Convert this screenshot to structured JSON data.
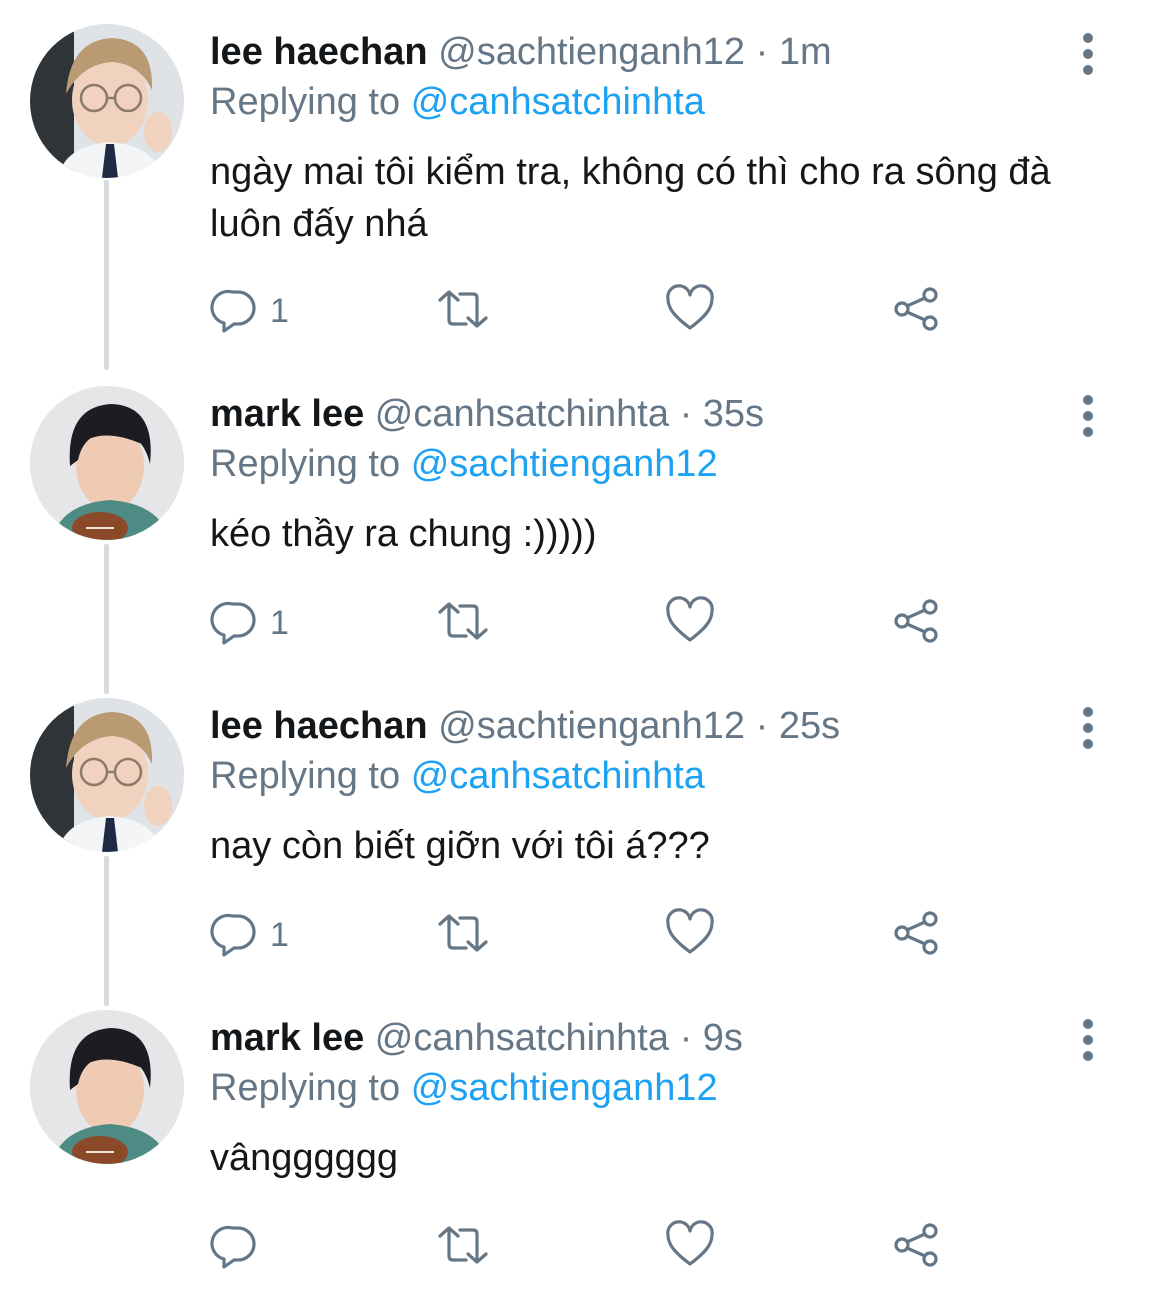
{
  "tweets": [
    {
      "name": "lee haechan",
      "handle": "@sachtienganh12",
      "separator": "·",
      "time": "1m",
      "replying_prefix": "Replying to",
      "replying_to": "@canhsatchinhta",
      "text": "ngày mai tôi kiểm tra, không có thì cho ra sông đà luôn đấy nhá",
      "reply_count": "1",
      "avatar": "haechan-avatar"
    },
    {
      "name": "mark lee",
      "handle": "@canhsatchinhta",
      "separator": "·",
      "time": "35s",
      "replying_prefix": "Replying to",
      "replying_to": "@sachtienganh12",
      "text": "kéo thầy ra chung :)))))",
      "reply_count": "1",
      "avatar": "mark-avatar"
    },
    {
      "name": "lee haechan",
      "handle": "@sachtienganh12",
      "separator": "·",
      "time": "25s",
      "replying_prefix": "Replying to",
      "replying_to": "@canhsatchinhta",
      "text": "nay còn biết giỡn với tôi á???",
      "reply_count": "1",
      "avatar": "haechan-avatar"
    },
    {
      "name": "mark lee",
      "handle": "@canhsatchinhta",
      "separator": "·",
      "time": "9s",
      "replying_prefix": "Replying to",
      "replying_to": "@sachtienganh12",
      "text": "vângggggg",
      "reply_count": "",
      "avatar": "mark-avatar"
    }
  ],
  "icons": {
    "reply": "reply-icon",
    "retweet": "retweet-icon",
    "like": "heart-icon",
    "share": "share-icon",
    "more": "more-options-icon"
  },
  "colors": {
    "text": "#14171a",
    "secondary": "#657786",
    "link": "#1da1f2",
    "icon": "#657786",
    "thread_line": "#d7dbdf"
  }
}
